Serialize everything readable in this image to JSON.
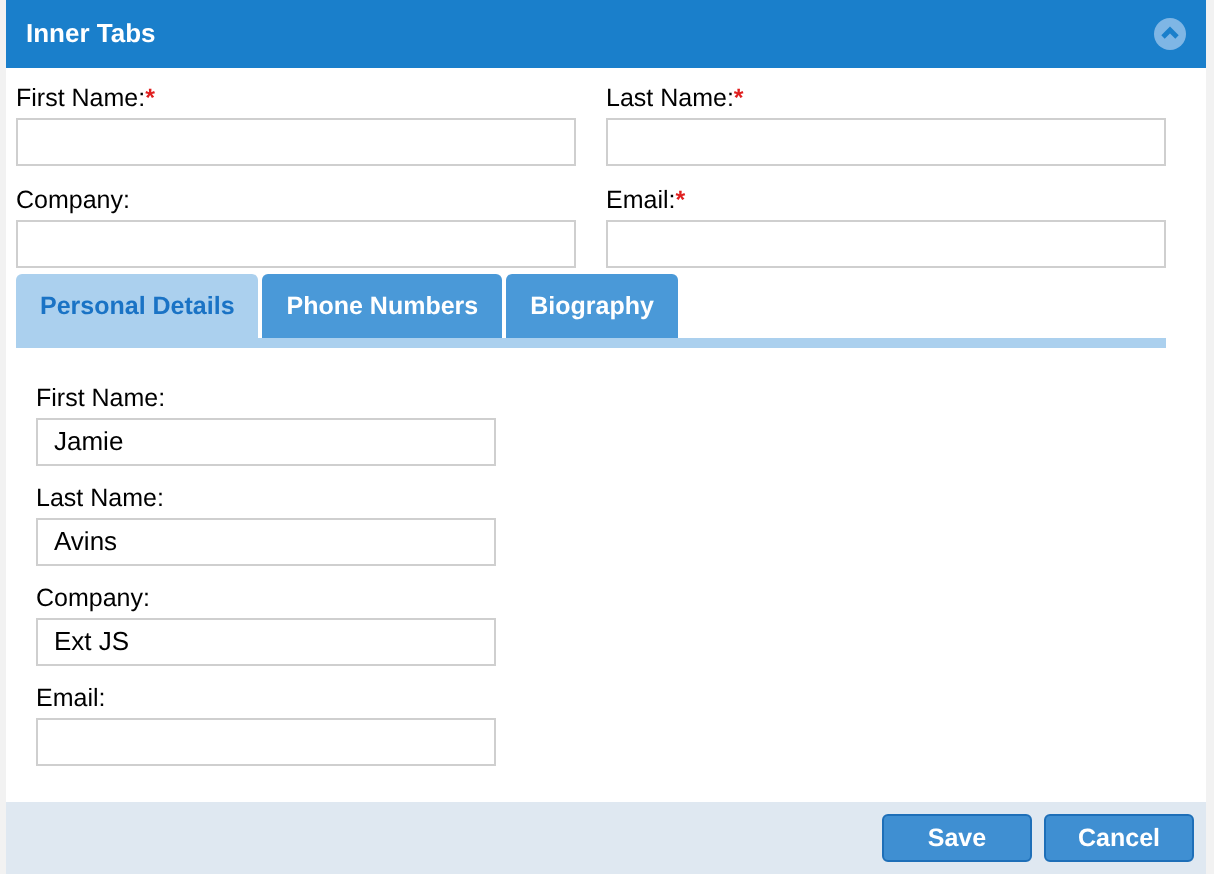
{
  "panel": {
    "title": "Inner Tabs",
    "collapsed": false
  },
  "fields": [
    {
      "label": "First Name:",
      "required_mark": "*"
    },
    {
      "label": "Last Name:",
      "required_mark": "*"
    },
    {
      "label": "Company:"
    },
    {
      "label": "Email:",
      "required_mark": "*"
    }
  ],
  "tabs": [
    {
      "label": "Personal Details",
      "selected": true
    },
    {
      "label": "Phone Numbers",
      "selected": false
    },
    {
      "label": "Biography",
      "selected": false
    }
  ],
  "tab_fields": [
    {
      "label": "First Name:",
      "value": "Jamie"
    },
    {
      "label": "Last Name:",
      "value": "Avins"
    },
    {
      "label": "Company:",
      "value": "Ext JS"
    },
    {
      "label": "Email:"
    }
  ],
  "buttons": [
    "Save",
    "Cancel"
  ]
}
